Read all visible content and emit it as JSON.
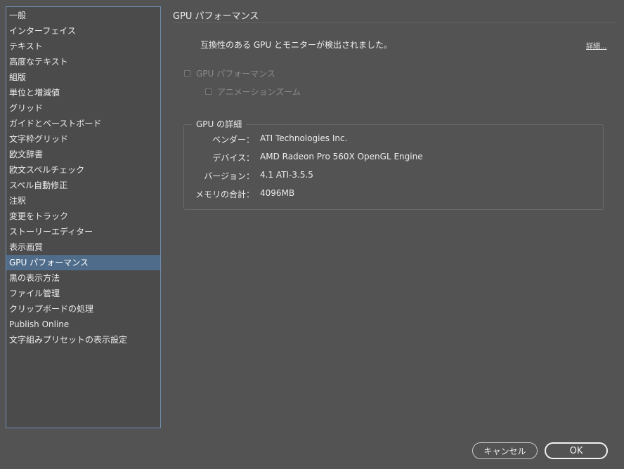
{
  "sidebar": {
    "items": [
      {
        "label": "一般"
      },
      {
        "label": "インターフェイス"
      },
      {
        "label": "テキスト"
      },
      {
        "label": "高度なテキスト"
      },
      {
        "label": "組版"
      },
      {
        "label": "単位と増減値"
      },
      {
        "label": "グリッド"
      },
      {
        "label": "ガイドとペーストボード"
      },
      {
        "label": "文字枠グリッド"
      },
      {
        "label": "欧文辞書"
      },
      {
        "label": "欧文スペルチェック"
      },
      {
        "label": "スペル自動修正"
      },
      {
        "label": "注釈"
      },
      {
        "label": "変更をトラック"
      },
      {
        "label": "ストーリーエディター"
      },
      {
        "label": "表示画質"
      },
      {
        "label": "GPU パフォーマンス",
        "selected": true
      },
      {
        "label": "黒の表示方法"
      },
      {
        "label": "ファイル管理"
      },
      {
        "label": "クリップボードの処理"
      },
      {
        "label": "Publish Online"
      },
      {
        "label": "文字組みプリセットの表示設定"
      }
    ]
  },
  "panel": {
    "title": "GPU パフォーマンス",
    "compat_message": "互換性のある GPU とモニターが検出されました。",
    "details_link": "詳細...",
    "gpu_checkbox_label": "GPU パフォーマンス",
    "animated_zoom_label": "アニメーションズーム",
    "gpu_checkbox_checked": false,
    "animated_zoom_checked": false
  },
  "gpu_details": {
    "legend": "GPU の詳細",
    "rows": [
      {
        "label": "ベンダー：",
        "value": "ATI Technologies Inc."
      },
      {
        "label": "デバイス：",
        "value": "AMD Radeon Pro 560X OpenGL Engine"
      },
      {
        "label": "バージョン：",
        "value": "4.1 ATI-3.5.5"
      },
      {
        "label": "メモリの合計：",
        "value": "4096MB"
      }
    ]
  },
  "buttons": {
    "cancel": "キャンセル",
    "ok": "OK"
  }
}
